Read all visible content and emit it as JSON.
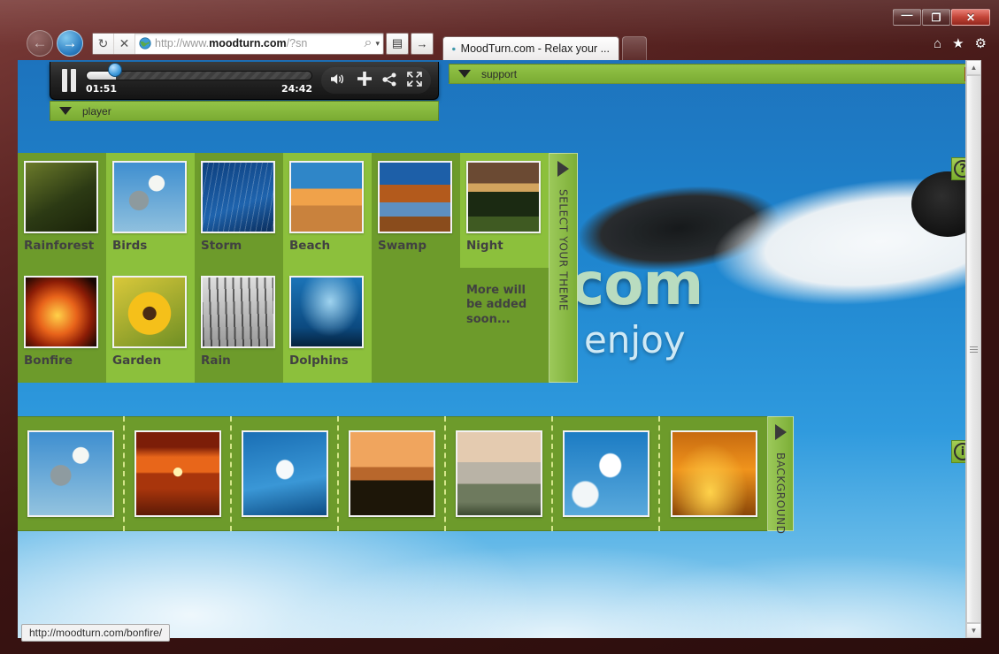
{
  "window": {
    "controls": [
      {
        "name": "minimize",
        "glyph": "—"
      },
      {
        "name": "maximize",
        "glyph": "❐"
      },
      {
        "name": "close",
        "glyph": "✕"
      }
    ]
  },
  "browser": {
    "back_icon": "←",
    "forward_icon": "→",
    "reload_icon": "↻",
    "stop_icon": "✕",
    "globe_icon": "🌐",
    "url_prefix": "http://www.",
    "url_domain": "moodturn.com",
    "url_suffix": "/?sn",
    "search_icon": "⌕",
    "dropdown_icon": "▾",
    "compat_icon": "▤",
    "go_icon": "→",
    "tabs": [
      {
        "favicon": "🌐",
        "title": "MoodTurn.com - Relax your ..."
      }
    ],
    "new_tab_label": "",
    "toolbar_icons": [
      {
        "name": "home-icon",
        "glyph": "⌂"
      },
      {
        "name": "favorites-icon",
        "glyph": "★"
      },
      {
        "name": "settings-icon",
        "glyph": "⚙"
      }
    ],
    "status_text": "http://moodturn.com/bonfire/",
    "scrollbar": {
      "up": "▲",
      "down": "▼"
    }
  },
  "site": {
    "wordmark": ".com",
    "tagline": "u enjoy"
  },
  "player": {
    "pause_label": "pause",
    "current_time": "01:51",
    "total_time": "24:42",
    "progress_percent": 13,
    "tools": [
      {
        "name": "volume-icon",
        "glyph": "🔊"
      },
      {
        "name": "add-icon",
        "glyph": "+"
      },
      {
        "name": "share-icon",
        "glyph": "≺"
      },
      {
        "name": "fullscreen-icon",
        "glyph": "⛶"
      }
    ],
    "panel_label": "player",
    "collapse_icon": "▼"
  },
  "support": {
    "label": "support",
    "collapse_icon": "▼"
  },
  "theme_panel": {
    "tab_label": "SELECT YOUR THEME",
    "tab_arrow": "▶",
    "coming_soon": "More will be added soon...",
    "columns": [
      {
        "shade": "even",
        "cells": [
          {
            "label": "Rainforest",
            "thumb": "rainforest"
          },
          {
            "label": "Bonfire",
            "thumb": "bonfire"
          }
        ]
      },
      {
        "shade": "odd",
        "cells": [
          {
            "label": "Birds",
            "thumb": "birds"
          },
          {
            "label": "Garden",
            "thumb": "garden"
          }
        ]
      },
      {
        "shade": "even",
        "cells": [
          {
            "label": "Storm",
            "thumb": "storm"
          },
          {
            "label": "Rain",
            "thumb": "rain"
          }
        ]
      },
      {
        "shade": "odd",
        "cells": [
          {
            "label": "Beach",
            "thumb": "beach"
          },
          {
            "label": "Dolphins",
            "thumb": "dolphins"
          }
        ]
      },
      {
        "shade": "even",
        "cells": [
          {
            "label": "Swamp",
            "thumb": "swamp"
          },
          {
            "label": "",
            "thumb": ""
          }
        ]
      },
      {
        "shade": "odd",
        "cells": [
          {
            "label": "Night",
            "thumb": "night"
          },
          {
            "label": "",
            "thumb": "soon"
          }
        ]
      }
    ]
  },
  "background_panel": {
    "tab_label": "BACKGROUND",
    "tab_arrow": "▶",
    "thumbs": [
      {
        "name": "bird-blossom"
      },
      {
        "name": "sunset-sea"
      },
      {
        "name": "albatross-sky"
      },
      {
        "name": "savanna-dusk"
      },
      {
        "name": "misty-farm"
      },
      {
        "name": "snow-geese"
      },
      {
        "name": "golden-dunes"
      }
    ]
  },
  "side_buttons": [
    {
      "name": "help-button",
      "glyph": "?"
    },
    {
      "name": "info-button",
      "glyph": "i"
    }
  ]
}
